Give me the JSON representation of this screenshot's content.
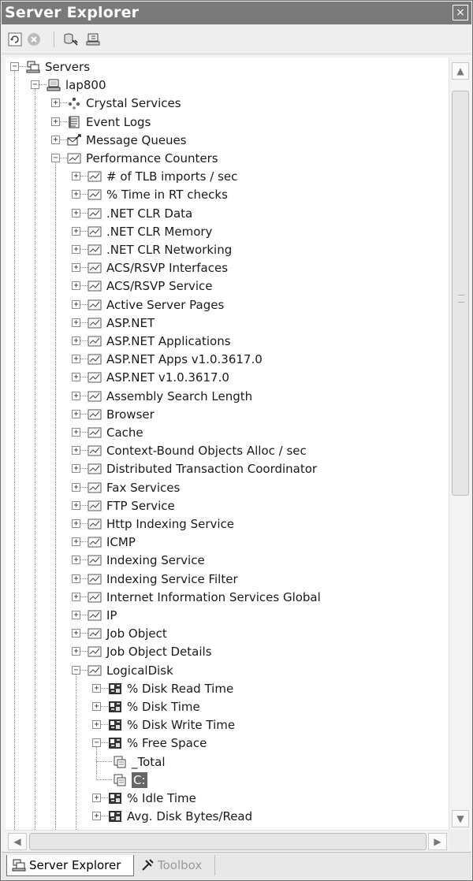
{
  "window": {
    "title": "Server Explorer",
    "close_glyph": "×"
  },
  "toolbar": {
    "buttons": [
      {
        "name": "refresh-icon"
      },
      {
        "name": "stop-icon"
      },
      {
        "name": "connect-to-database-icon"
      },
      {
        "name": "connect-to-server-icon"
      }
    ]
  },
  "tree": {
    "nodes": [
      {
        "label": "Servers",
        "depth": 0,
        "expander": "minus",
        "icon": "servers-icon"
      },
      {
        "label": "lap800",
        "depth": 1,
        "expander": "minus",
        "icon": "computer-icon"
      },
      {
        "label": "Crystal Services",
        "depth": 2,
        "expander": "plus",
        "icon": "crystal-services-icon"
      },
      {
        "label": "Event Logs",
        "depth": 2,
        "expander": "plus",
        "icon": "event-log-icon"
      },
      {
        "label": "Message Queues",
        "depth": 2,
        "expander": "plus",
        "icon": "message-queue-icon"
      },
      {
        "label": "Performance Counters",
        "depth": 2,
        "expander": "minus",
        "icon": "performance-chart-icon"
      },
      {
        "label": "# of TLB imports / sec",
        "depth": 3,
        "expander": "plus",
        "icon": "performance-chart-icon"
      },
      {
        "label": "% Time in RT checks",
        "depth": 3,
        "expander": "plus",
        "icon": "performance-chart-icon"
      },
      {
        "label": ".NET CLR Data",
        "depth": 3,
        "expander": "plus",
        "icon": "performance-chart-icon"
      },
      {
        "label": ".NET CLR Memory",
        "depth": 3,
        "expander": "plus",
        "icon": "performance-chart-icon"
      },
      {
        "label": ".NET CLR Networking",
        "depth": 3,
        "expander": "plus",
        "icon": "performance-chart-icon"
      },
      {
        "label": "ACS/RSVP Interfaces",
        "depth": 3,
        "expander": "plus",
        "icon": "performance-chart-icon"
      },
      {
        "label": "ACS/RSVP Service",
        "depth": 3,
        "expander": "plus",
        "icon": "performance-chart-icon"
      },
      {
        "label": "Active Server Pages",
        "depth": 3,
        "expander": "plus",
        "icon": "performance-chart-icon"
      },
      {
        "label": "ASP.NET",
        "depth": 3,
        "expander": "plus",
        "icon": "performance-chart-icon"
      },
      {
        "label": "ASP.NET Applications",
        "depth": 3,
        "expander": "plus",
        "icon": "performance-chart-icon"
      },
      {
        "label": "ASP.NET Apps v1.0.3617.0",
        "depth": 3,
        "expander": "plus",
        "icon": "performance-chart-icon"
      },
      {
        "label": "ASP.NET v1.0.3617.0",
        "depth": 3,
        "expander": "plus",
        "icon": "performance-chart-icon"
      },
      {
        "label": "Assembly Search Length",
        "depth": 3,
        "expander": "plus",
        "icon": "performance-chart-icon"
      },
      {
        "label": "Browser",
        "depth": 3,
        "expander": "plus",
        "icon": "performance-chart-icon"
      },
      {
        "label": "Cache",
        "depth": 3,
        "expander": "plus",
        "icon": "performance-chart-icon"
      },
      {
        "label": "Context-Bound Objects Alloc / sec",
        "depth": 3,
        "expander": "plus",
        "icon": "performance-chart-icon"
      },
      {
        "label": "Distributed Transaction Coordinator",
        "depth": 3,
        "expander": "plus",
        "icon": "performance-chart-icon"
      },
      {
        "label": "Fax Services",
        "depth": 3,
        "expander": "plus",
        "icon": "performance-chart-icon"
      },
      {
        "label": "FTP Service",
        "depth": 3,
        "expander": "plus",
        "icon": "performance-chart-icon"
      },
      {
        "label": "Http Indexing Service",
        "depth": 3,
        "expander": "plus",
        "icon": "performance-chart-icon"
      },
      {
        "label": "ICMP",
        "depth": 3,
        "expander": "plus",
        "icon": "performance-chart-icon"
      },
      {
        "label": "Indexing Service",
        "depth": 3,
        "expander": "plus",
        "icon": "performance-chart-icon"
      },
      {
        "label": "Indexing Service Filter",
        "depth": 3,
        "expander": "plus",
        "icon": "performance-chart-icon"
      },
      {
        "label": "Internet Information Services Global",
        "depth": 3,
        "expander": "plus",
        "icon": "performance-chart-icon"
      },
      {
        "label": "IP",
        "depth": 3,
        "expander": "plus",
        "icon": "performance-chart-icon"
      },
      {
        "label": "Job Object",
        "depth": 3,
        "expander": "plus",
        "icon": "performance-chart-icon"
      },
      {
        "label": "Job Object Details",
        "depth": 3,
        "expander": "plus",
        "icon": "performance-chart-icon"
      },
      {
        "label": "LogicalDisk",
        "depth": 3,
        "expander": "minus",
        "icon": "performance-chart-icon"
      },
      {
        "label": "% Disk Read Time",
        "depth": 4,
        "expander": "plus",
        "icon": "counter-icon"
      },
      {
        "label": "% Disk Time",
        "depth": 4,
        "expander": "plus",
        "icon": "counter-icon"
      },
      {
        "label": "% Disk Write Time",
        "depth": 4,
        "expander": "plus",
        "icon": "counter-icon"
      },
      {
        "label": "% Free Space",
        "depth": 4,
        "expander": "minus",
        "icon": "counter-icon"
      },
      {
        "label": "_Total",
        "depth": 5,
        "expander": "none",
        "icon": "instance-icon"
      },
      {
        "label": "C:",
        "depth": 5,
        "expander": "none",
        "icon": "instance-icon",
        "selected": true
      },
      {
        "label": "% Idle Time",
        "depth": 4,
        "expander": "plus",
        "icon": "counter-icon"
      },
      {
        "label": "Avg. Disk Bytes/Read",
        "depth": 4,
        "expander": "plus",
        "icon": "counter-icon"
      }
    ]
  },
  "scrollbars": {
    "up": "▲",
    "down": "▼",
    "left": "◀",
    "right": "▶"
  },
  "tabs": [
    {
      "label": "Server Explorer",
      "icon": "server-explorer-icon",
      "active": true
    },
    {
      "label": "Toolbox",
      "icon": "toolbox-icon",
      "active": false
    }
  ]
}
